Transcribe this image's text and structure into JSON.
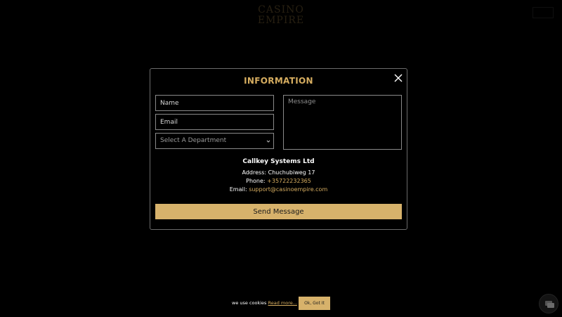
{
  "header": {
    "left_links": "",
    "logo_line1": "CASINO EMPIRE",
    "logo_line2": "",
    "right_button": ""
  },
  "modal": {
    "title": "INFORMATION",
    "name_placeholder": "Name",
    "email_placeholder": "Email",
    "department_placeholder": "Select A Department",
    "message_placeholder": "Message",
    "company_name": "Callkey Systems Ltd",
    "address_label": "Address: ",
    "address_value": "Chuchubiweg 17",
    "phone_label": "Phone: ",
    "phone_value": "+35722232365",
    "email_label": "Email: ",
    "email_value": "support@casinoempire.com",
    "send_label": "Send Message"
  },
  "cookie": {
    "text": "we use cookies ",
    "link": "Read more...",
    "button": "Ok, Got It"
  },
  "colors": {
    "accent": "#d6ad60",
    "button_bg": "#d7b26b",
    "background": "#000000",
    "border": "#8a8a8a"
  },
  "icons": {
    "close": "close-icon",
    "select_arrow": "chevron-down-icon",
    "chat": "chat-icon"
  }
}
